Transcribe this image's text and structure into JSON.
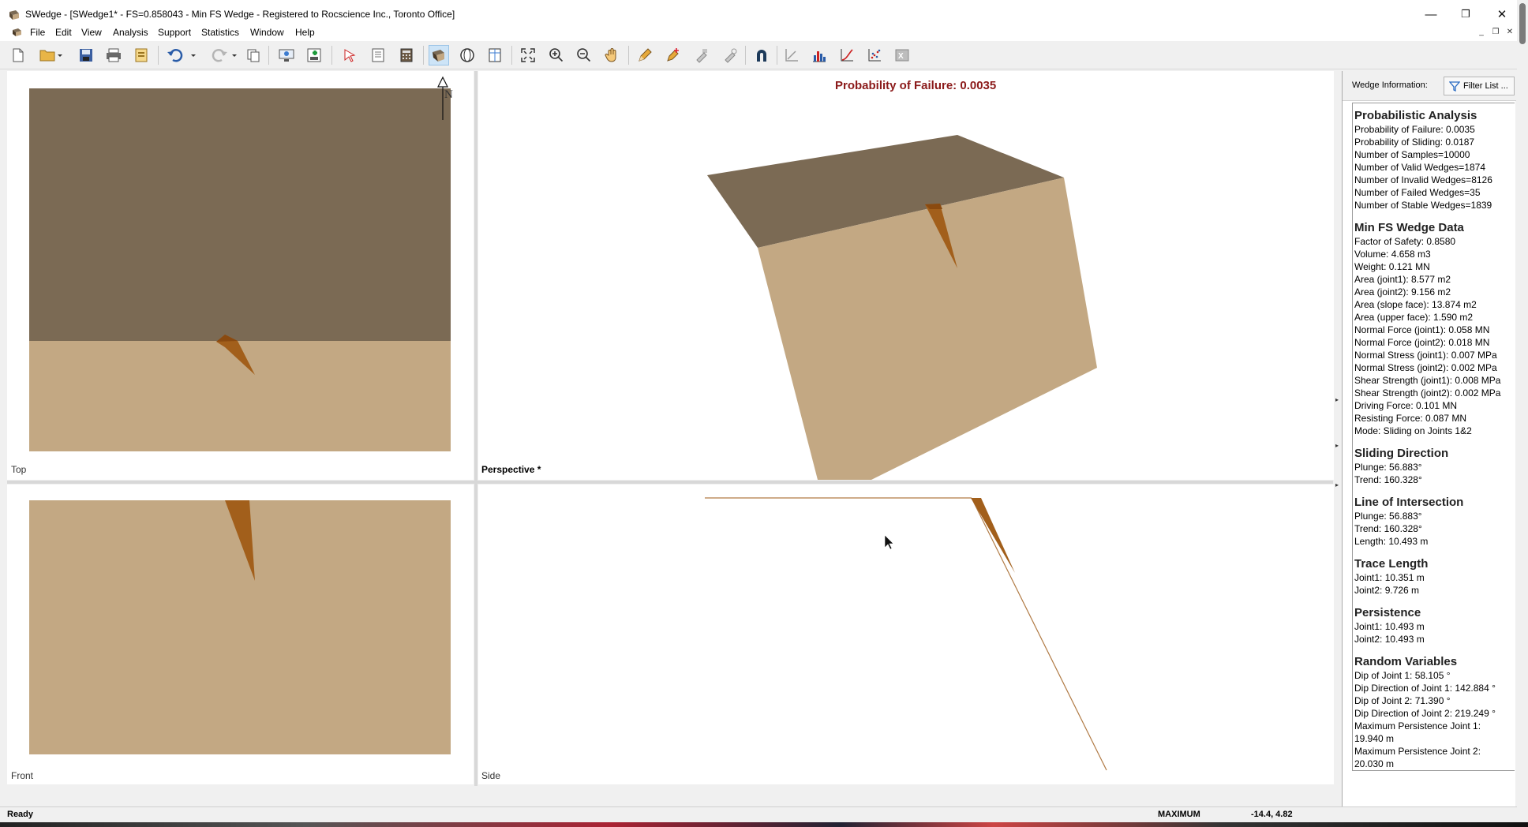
{
  "window": {
    "title": "SWedge - [SWedge1* - FS=0.858043 - Min FS Wedge - Registered to Rocscience Inc., Toronto Office]",
    "minimize_glyph": "—",
    "restore_glyph": "❐",
    "close_glyph": "✕"
  },
  "menu": {
    "items": [
      "File",
      "Edit",
      "View",
      "Analysis",
      "Support",
      "Statistics",
      "Window",
      "Help"
    ]
  },
  "toolbar": {
    "icons": [
      "new-file",
      "open-folder",
      "save",
      "print",
      "export",
      "undo",
      "redo",
      "copy",
      "display-options",
      "add-support",
      "select",
      "info-viewer",
      "calculator",
      "wedge-view",
      "sphere-view",
      "split-view",
      "zoom-extents",
      "zoom-in",
      "zoom-out",
      "pan",
      "pencil",
      "add-pencil",
      "tool-a",
      "tool-b",
      "magnet",
      "axes",
      "histogram",
      "cumulative",
      "scatter",
      "excel"
    ]
  },
  "viewports": {
    "top_label": "Top",
    "perspective_label": "Perspective *",
    "front_label": "Front",
    "side_label": "Side",
    "probability_title": "Probability of Failure: 0.0035",
    "north_label": "N"
  },
  "colors": {
    "upper_face": "#7b6a54",
    "slope_face": "#c3a883",
    "wedge_dark": "#8a4a10",
    "wedge_mid": "#a25f1b",
    "probability_title": "#8b1a1a",
    "side_line": "#b07a44"
  },
  "info_panel": {
    "header_label": "Wedge Information:",
    "filter_button": "Filter List ...",
    "sections": [
      {
        "title": "Probabilistic Analysis",
        "lines": [
          "Probability of Failure: 0.0035",
          "Probability of Sliding: 0.0187",
          "Number of Samples=10000",
          "Number of Valid Wedges=1874",
          "Number of Invalid Wedges=8126",
          "Number of Failed Wedges=35",
          "Number of Stable Wedges=1839"
        ]
      },
      {
        "title": "Min FS Wedge Data",
        "lines": [
          "Factor of Safety: 0.8580",
          "Volume: 4.658 m3",
          "Weight: 0.121 MN",
          "Area (joint1): 8.577 m2",
          "Area (joint2): 9.156 m2",
          "Area (slope face): 13.874 m2",
          "Area (upper face): 1.590 m2",
          "Normal Force (joint1): 0.058 MN",
          "Normal Force (joint2): 0.018 MN",
          "Normal Stress (joint1): 0.007 MPa",
          "Normal Stress (joint2): 0.002 MPa",
          "Shear Strength (joint1): 0.008 MPa",
          "Shear Strength (joint2): 0.002 MPa",
          "Driving Force: 0.101 MN",
          "Resisting Force: 0.087 MN",
          "Mode: Sliding on Joints 1&2"
        ]
      },
      {
        "title": "Sliding Direction",
        "lines": [
          "Plunge: 56.883°",
          "Trend: 160.328°"
        ]
      },
      {
        "title": "Line of Intersection",
        "lines": [
          "Plunge: 56.883°",
          "Trend: 160.328°",
          "Length: 10.493 m"
        ]
      },
      {
        "title": "Trace Length",
        "lines": [
          "Joint1: 10.351 m",
          "Joint2: 9.726 m"
        ]
      },
      {
        "title": "Persistence",
        "lines": [
          "Joint1: 10.493 m",
          "Joint2: 10.493 m"
        ]
      },
      {
        "title": "Random Variables",
        "lines": [
          "Dip of Joint 1: 58.105 °",
          "Dip Direction of Joint 1: 142.884 °",
          "Dip of Joint 2: 71.390 °",
          "Dip Direction of Joint 2: 219.249 °",
          "Maximum Persistence Joint 1:",
          "19.940 m",
          "Maximum Persistence Joint 2:",
          "20.030 m"
        ]
      }
    ]
  },
  "status": {
    "ready": "Ready",
    "mode": "MAXIMUM",
    "coords": "-14.4, 4.82"
  }
}
